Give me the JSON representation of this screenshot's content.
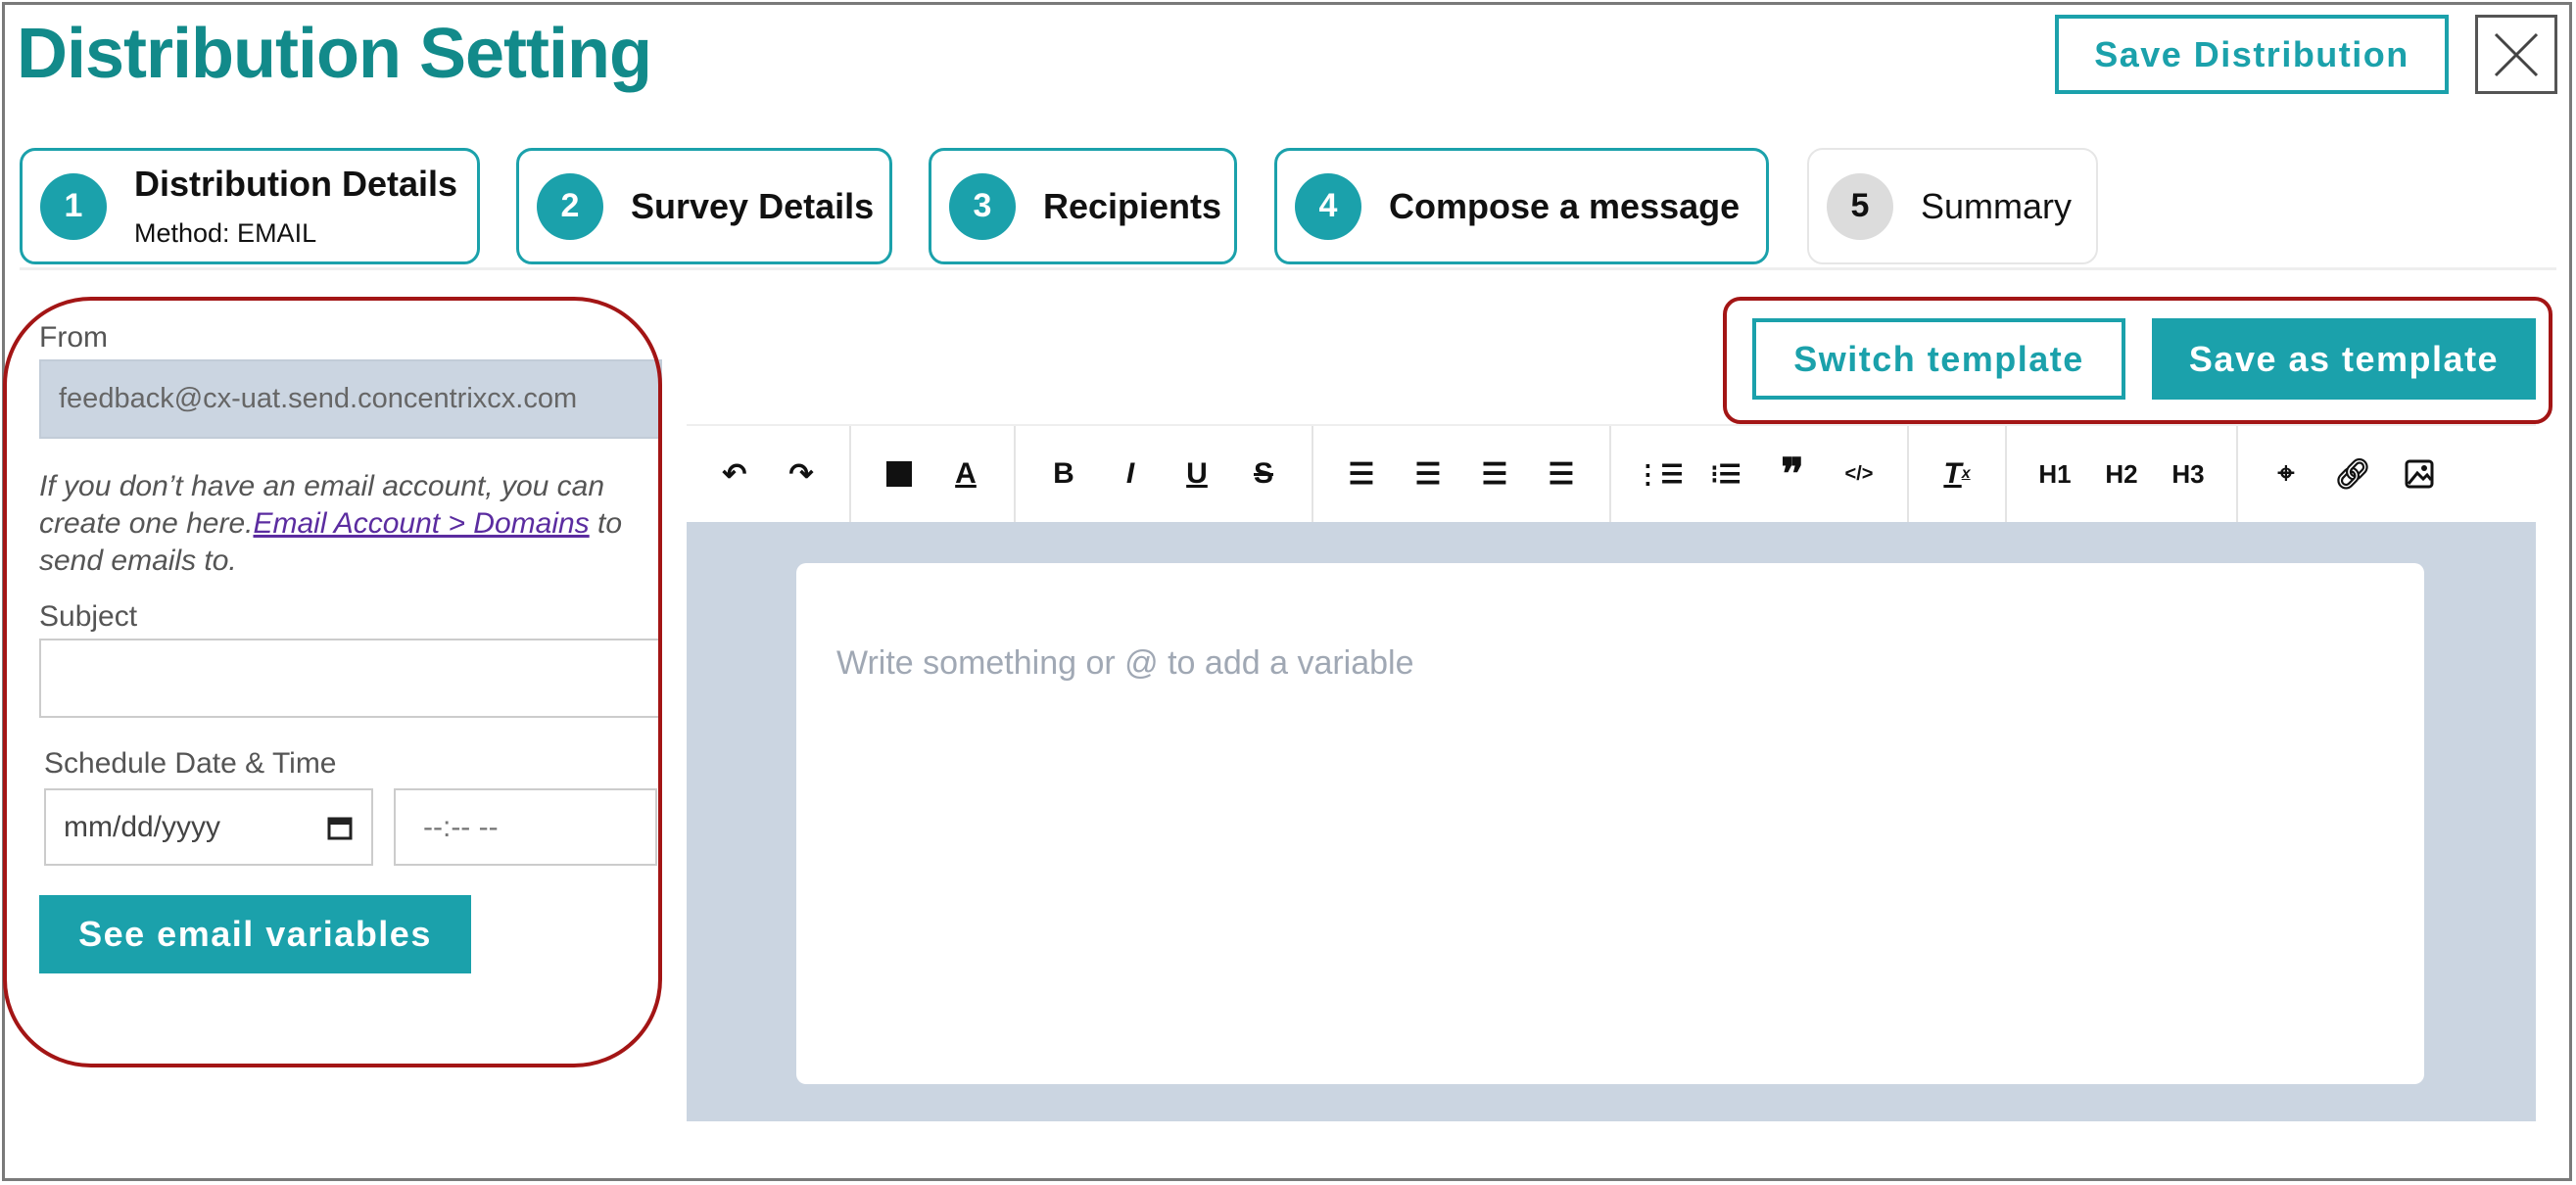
{
  "header": {
    "title": "Distribution Setting",
    "save_label": "Save Distribution",
    "close_icon": "close-icon"
  },
  "steps": [
    {
      "num": "1",
      "label": "Distribution Details",
      "sub": "Method: EMAIL",
      "state": "done"
    },
    {
      "num": "2",
      "label": "Survey Details",
      "state": "done"
    },
    {
      "num": "3",
      "label": "Recipients",
      "state": "done"
    },
    {
      "num": "4",
      "label": "Compose a message",
      "state": "active"
    },
    {
      "num": "5",
      "label": "Summary",
      "state": "inactive"
    }
  ],
  "form": {
    "from_label": "From",
    "from_value": "feedback@cx-uat.send.concentrixcx.com",
    "helper_pre": "If you don’t have an email account, you can create one here.",
    "helper_link": "Email Account > Domains",
    "helper_post": " to send emails to.",
    "subject_label": "Subject",
    "subject_value": "",
    "schedule_label": "Schedule Date & Time",
    "date_placeholder": "mm/dd/yyyy",
    "time_placeholder": "--:-- --",
    "variables_button": "See email variables"
  },
  "templates": {
    "switch_label": "Switch template",
    "save_label": "Save as template"
  },
  "toolbar": {
    "h1": "H1",
    "h2": "H2",
    "h3": "H3"
  },
  "editor": {
    "placeholder": "Write something or @ to add a variable"
  },
  "colors": {
    "accent": "#1ba1ab",
    "title": "#128a8a",
    "highlight": "#a31515",
    "editor_bg": "#cbd5e1"
  }
}
